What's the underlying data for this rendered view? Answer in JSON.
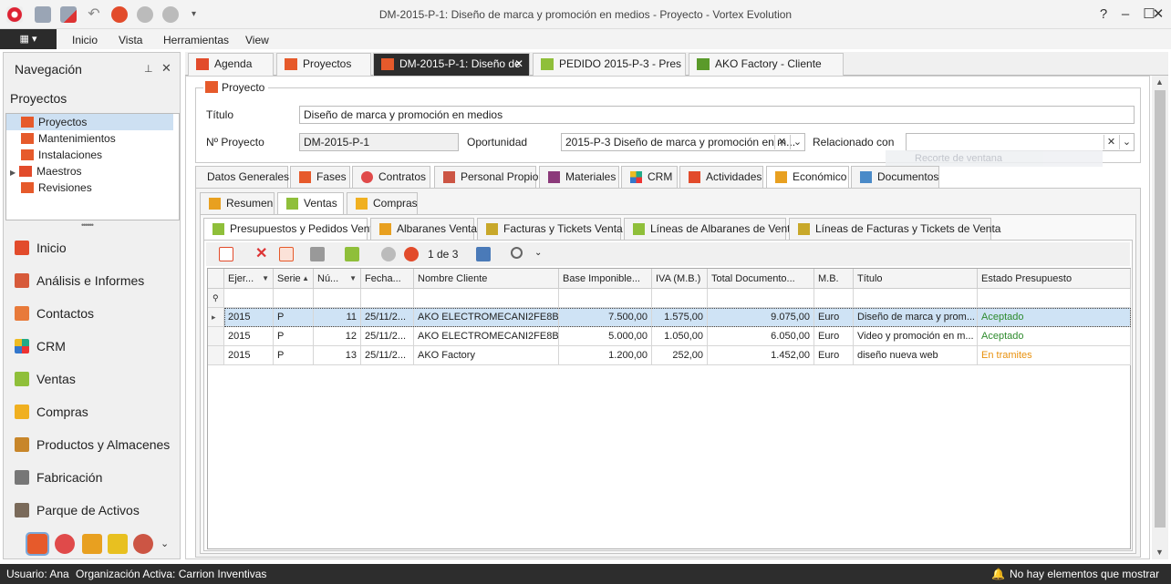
{
  "window": {
    "title": "DM-2015-P-1: Diseño de marca y promoción en medios - Proyecto - Vortex Evolution"
  },
  "menu": {
    "items": [
      "Inicio",
      "Vista",
      "Herramientas",
      "View"
    ]
  },
  "nav": {
    "title": "Navegación",
    "section": "Proyectos",
    "tree": [
      "Proyectos",
      "Mantenimientos",
      "Instalaciones",
      "Maestros",
      "Revisiones"
    ],
    "modules": [
      "Inicio",
      "Análisis e Informes",
      "Contactos",
      "CRM",
      "Ventas",
      "Compras",
      "Productos y Almacenes",
      "Fabricación",
      "Parque de Activos"
    ]
  },
  "doctabs": [
    "Agenda",
    "Proyectos",
    "DM-2015-P-1: Diseño de",
    "PEDIDO 2015-P-3 - Pres",
    "AKO Factory - Cliente"
  ],
  "form": {
    "group_title": "Proyecto",
    "titulo_label": "Título",
    "titulo_value": "Diseño de marca y promoción en medios",
    "nproyecto_label": "Nº Proyecto",
    "nproyecto_value": "DM-2015-P-1",
    "oportunidad_label": "Oportunidad",
    "oportunidad_value": "2015-P-3 Diseño de marca y promoción en m...",
    "relacionado_label": "Relacionado con",
    "relacionado_value": "",
    "ghost_text": "Recorte de ventana"
  },
  "tabs1": [
    "Datos Generales",
    "Fases",
    "Contratos",
    "Personal Propio",
    "Materiales",
    "CRM",
    "Actividades",
    "Económico",
    "Documentos"
  ],
  "tabs2": [
    "Resumen",
    "Ventas",
    "Compras"
  ],
  "tabs3": [
    "Presupuestos y Pedidos Venta",
    "Albaranes Venta",
    "Facturas y Tickets Venta",
    "Líneas de Albaranes de Venta",
    "Líneas de Facturas y Tickets de Venta"
  ],
  "pager": "1 de 3",
  "grid": {
    "columns": [
      "Ejer...",
      "Serie",
      "Nú...",
      "Fecha...",
      "Nombre Cliente",
      "Base Imponible...",
      "IVA (M.B.)",
      "Total Documento...",
      "M.B.",
      "Título",
      "Estado Presupuesto"
    ],
    "rows": [
      [
        "2015",
        "P",
        "11",
        "25/11/2...",
        "AKO ELECTROMECANI2FE8B",
        "7.500,00",
        "1.575,00",
        "9.075,00",
        "Euro",
        "Diseño de marca y prom...",
        "Aceptado"
      ],
      [
        "2015",
        "P",
        "12",
        "25/11/2...",
        "AKO ELECTROMECANI2FE8B",
        "5.000,00",
        "1.050,00",
        "6.050,00",
        "Euro",
        "Video y promoción en m...",
        "Aceptado"
      ],
      [
        "2015",
        "P",
        "13",
        "25/11/2...",
        "AKO Factory",
        "1.200,00",
        "252,00",
        "1.452,00",
        "Euro",
        "diseño nueva web",
        "En tramites"
      ]
    ]
  },
  "status": {
    "user": "Usuario: Ana",
    "org": "Organización Activa: Carrion Inventivas",
    "notifications": "No hay elementos que mostrar"
  },
  "colors": {
    "accent": "#2d2d2d",
    "aceptado": "#2e8b2e",
    "tramites": "#e8900c",
    "selected_row": "#cfe3f5"
  }
}
